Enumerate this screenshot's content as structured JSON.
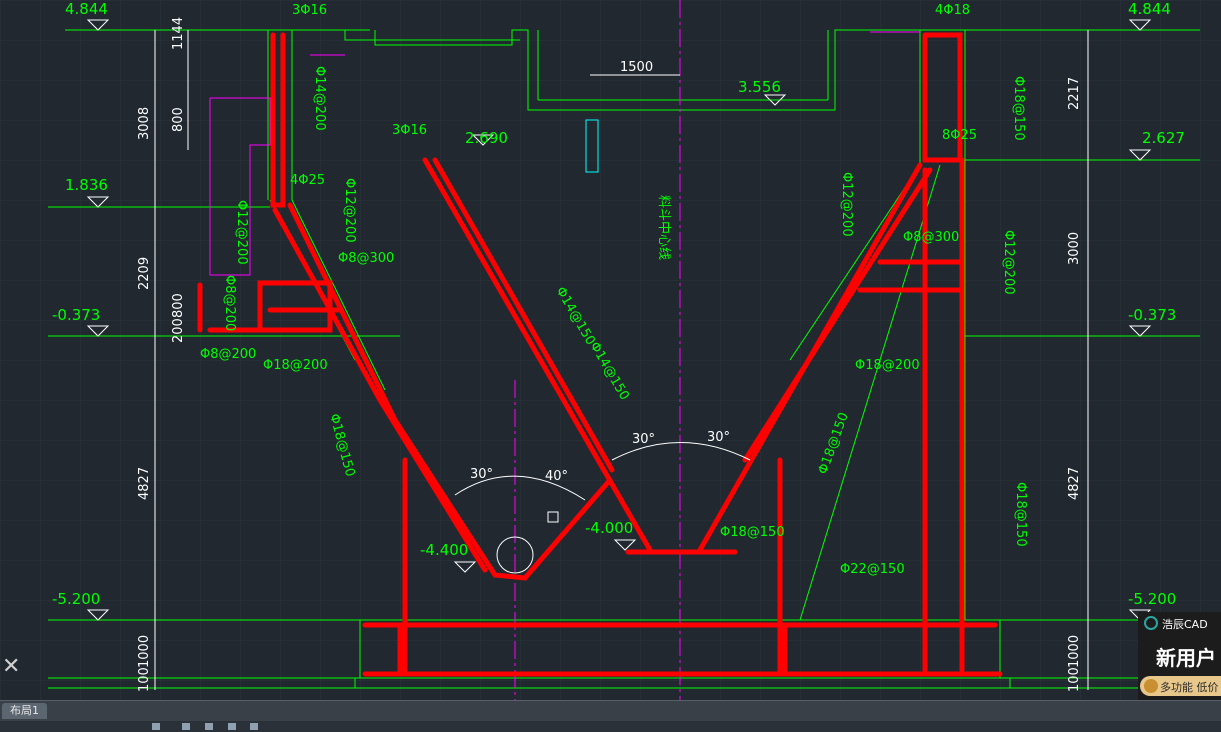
{
  "drawing": {
    "colors": {
      "bg": "#212830",
      "line": "#00ff00",
      "rebar": "#ff0000",
      "center": "#ff00ff",
      "text": "#00ff00",
      "dim": "#ffffff",
      "cyan": "#00ffff",
      "yellow": "#ffff66"
    },
    "elevations": [
      "4.844",
      "4.844",
      "1.836",
      "2.690",
      "2.627",
      "3.556",
      "-0.373",
      "-0.373",
      "-4.400",
      "-4.000",
      "-5.200",
      "-5.200"
    ],
    "dimensions_left": [
      "1144",
      "800",
      "3008",
      "2209",
      "800",
      "200",
      "4827",
      "1000",
      "100"
    ],
    "dimensions_right": [
      "2217",
      "3000",
      "4827",
      "1000",
      "100"
    ],
    "labels": [
      "3Φ16",
      "4Φ18",
      "Φ14@200",
      "1500",
      "3Φ16",
      "8Φ25",
      "Φ18@150",
      "4Φ25",
      "Φ12@200",
      "Φ12@200",
      "Φ8@300",
      "Φ8@300",
      "Φ12@200",
      "Φ12@200",
      "Φ8@200",
      "Φ8@200",
      "Φ18@200",
      "Φ18@200",
      "Φ14@150",
      "Φ14@150",
      "Φ18@150",
      "Φ18@150",
      "Φ18@150",
      "Φ18@150",
      "Φ22@150",
      "30°",
      "40°",
      "30°",
      "30°",
      "料斗中心线"
    ]
  },
  "tabs": {
    "layout": "布局1"
  },
  "ad": {
    "brand": "浩辰CAD",
    "title": "新用户",
    "subtitle": "多功能 低价"
  },
  "ucs_icon": "ucs-cross-icon"
}
